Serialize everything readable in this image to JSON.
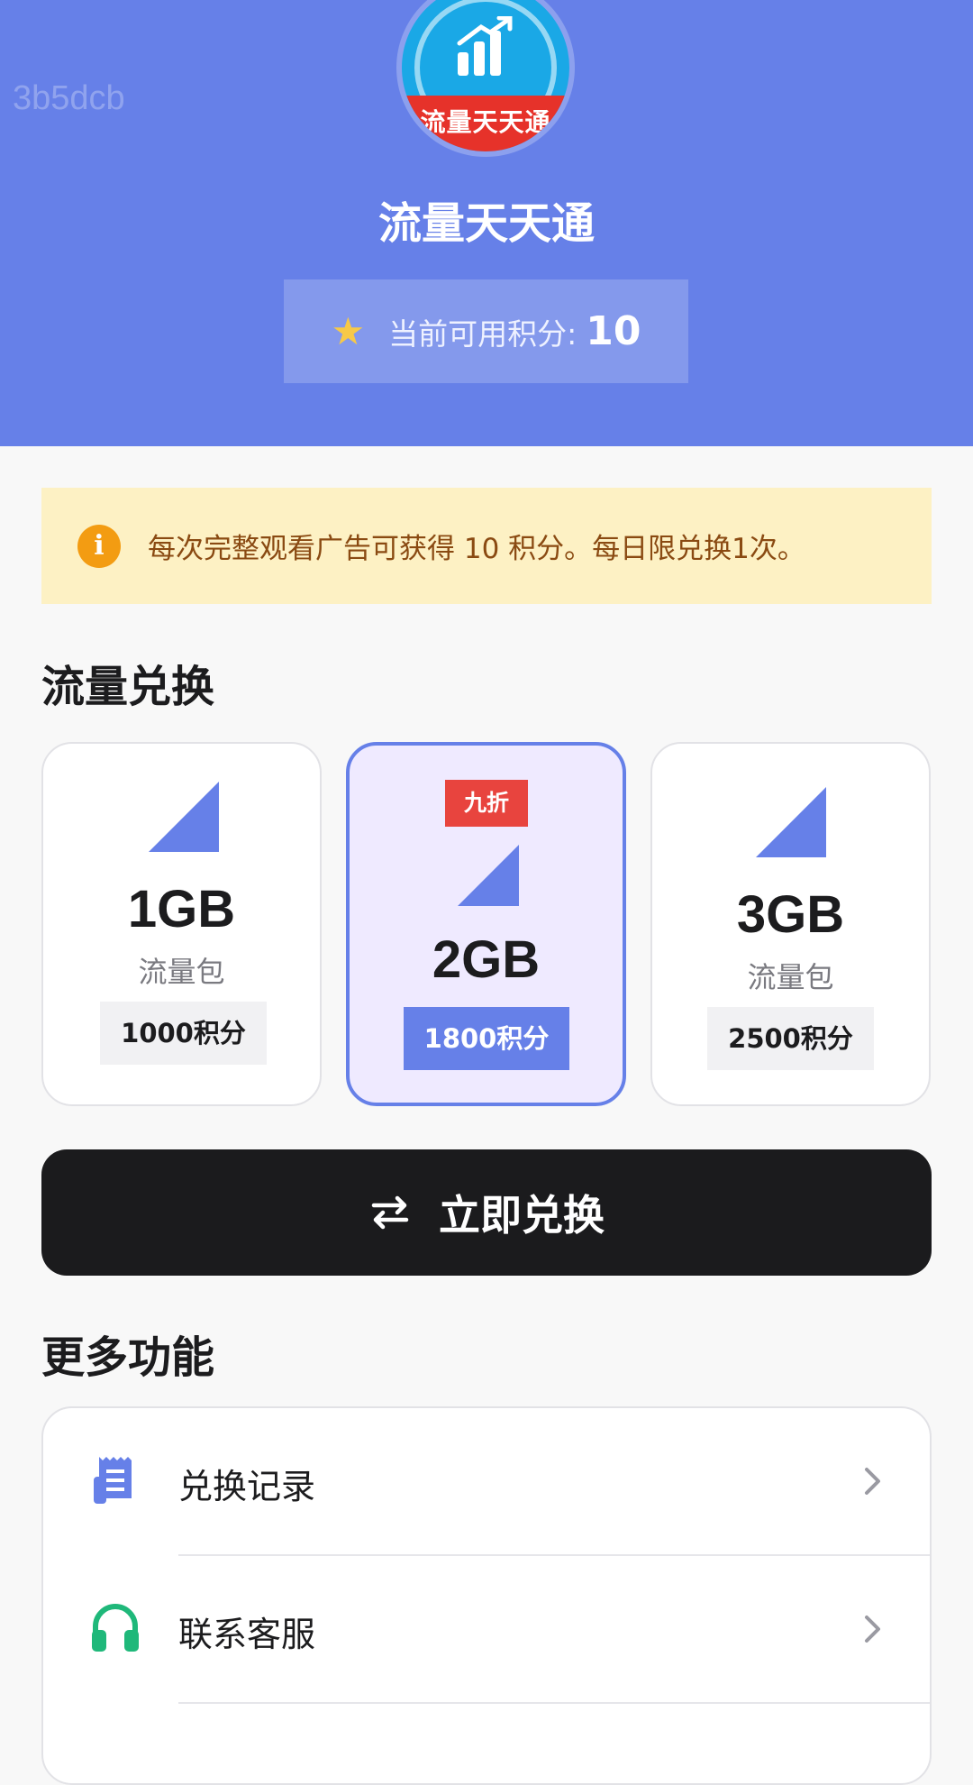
{
  "watermark": "3b5dcb",
  "app": {
    "logo_text": "流量天天通",
    "title": "流量天天通"
  },
  "points": {
    "label": "当前可用积分:",
    "value": "10"
  },
  "notice": {
    "text": "每次完整观看广告可获得 10 积分。每日限兑换1次。"
  },
  "exchange_section": {
    "title": "流量兑换",
    "packages": [
      {
        "amount": "1GB",
        "unit": "流量包",
        "price": "1000积分",
        "selected": false
      },
      {
        "amount": "2GB",
        "badge": "九折",
        "price": "1800积分",
        "selected": true
      },
      {
        "amount": "3GB",
        "unit": "流量包",
        "price": "2500积分",
        "selected": false
      }
    ]
  },
  "exchange_button": {
    "label": "立即兑换"
  },
  "more_section": {
    "title": "更多功能",
    "items": [
      {
        "label": "兑换记录",
        "icon": "receipt-icon"
      },
      {
        "label": "联系客服",
        "icon": "headset-icon"
      }
    ]
  },
  "colors": {
    "primary": "#6680e8",
    "notice_bg": "#fdf1c4",
    "badge": "#e8443e",
    "button_dark": "#1b1b1d",
    "headset_green": "#1fb87a"
  }
}
